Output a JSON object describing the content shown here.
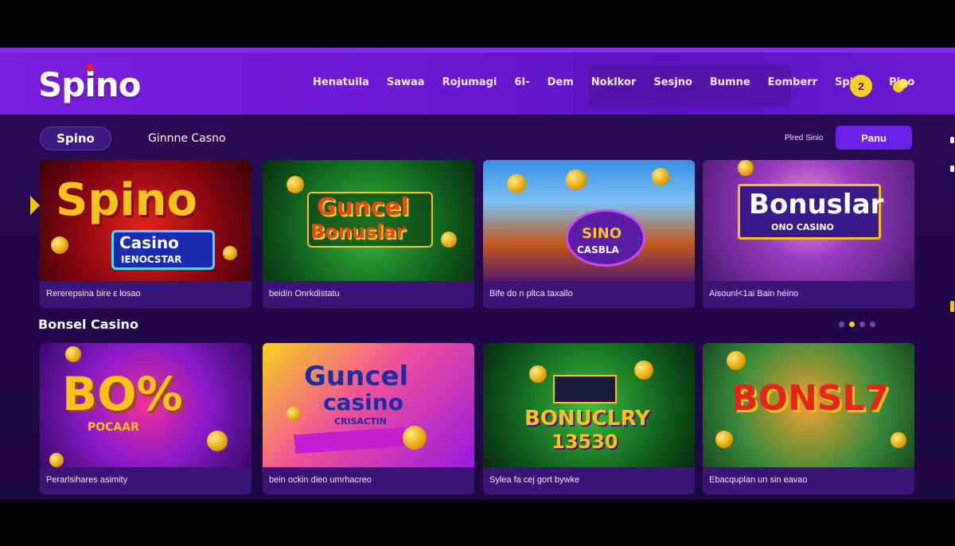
{
  "brand": {
    "logo": "Spino"
  },
  "nav": {
    "items": [
      "Henatuila",
      "Sawaa",
      "Rojumagi",
      "6I-",
      "Dem",
      "Noklkor",
      "Sesjno",
      "Bumne",
      "Eomberr",
      "Spinin",
      "Pino"
    ]
  },
  "header_actions": {
    "notification_count": "2"
  },
  "filters": {
    "active_tab": "Spino",
    "second_tab": "Ginnne Casno",
    "played_label": "Plred Sinio",
    "primary_button": "Panu"
  },
  "row1": [
    {
      "art_title": "Spino",
      "art_sub": "Casino",
      "art_sub2": "IENOCSTAR",
      "caption": "Rererepsina bire ε łosao",
      "colors": [
        "#b80d1e",
        "#f7c21a"
      ]
    },
    {
      "art_title": "Guncel",
      "art_sub": "Bonuslar",
      "caption": "beidin Onrkdistatu",
      "colors": [
        "#0d5a22",
        "#e84a12"
      ]
    },
    {
      "art_title": "SINO",
      "art_sub": "CASBLA",
      "caption": "Bife do n pltca taxallo",
      "colors": [
        "#1e7ad6",
        "#c61fd1"
      ]
    },
    {
      "art_title": "Bonuslar",
      "art_sub": "ONO CASINO",
      "caption": "Aisounl<1ai Bain héino",
      "colors": [
        "#7c2cb0",
        "#e8d4ff"
      ]
    }
  ],
  "section": {
    "title": "Bonsel Casino"
  },
  "row2": [
    {
      "art_title": "BO%",
      "art_sub": "POCAAR",
      "caption": "Perarlsihares asimity",
      "colors": [
        "#7a1ac8",
        "#f7c21a"
      ]
    },
    {
      "art_title": "Guncel",
      "art_sub": "casino",
      "art_sub2": "CRISACTIN",
      "caption": "bein ockin dieo umrhacreo",
      "colors": [
        "#e81bb8",
        "#1d2fa0"
      ]
    },
    {
      "art_title": "BONUCLRY",
      "art_sub": "13530",
      "caption": "Sylea fa cej gort bywke",
      "colors": [
        "#1a7a1e",
        "#c61fd1"
      ]
    },
    {
      "art_title": "BONSL7",
      "art_sub": "",
      "caption": "Ebacquplan un sin eavao",
      "colors": [
        "#c8731a",
        "#b80d1e"
      ]
    }
  ]
}
